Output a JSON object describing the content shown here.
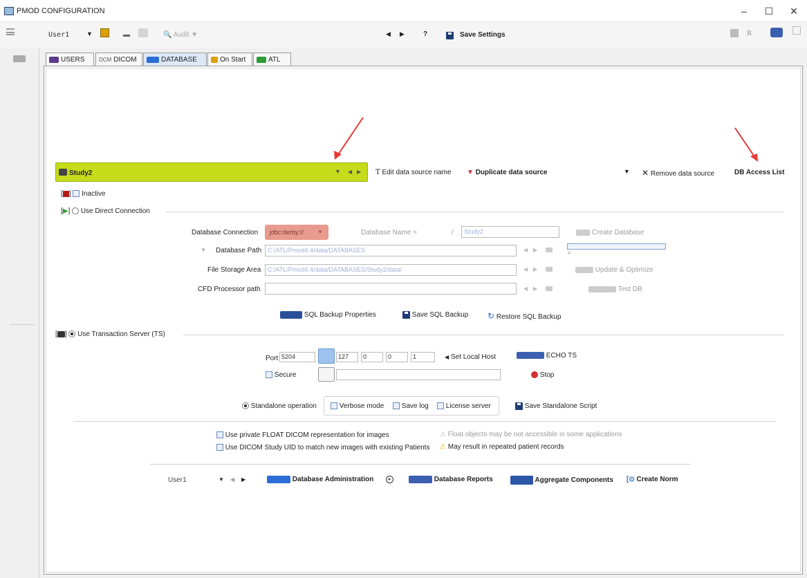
{
  "window": {
    "title": "PMOD CONFIGURATION",
    "minimize": "–",
    "maximize": "☐",
    "close": "✕"
  },
  "toolbar": {
    "user": "User1",
    "audit": "Audit",
    "help": "?",
    "save_settings": "Save Settings",
    "right_r": "R"
  },
  "tabs": [
    {
      "label": "USERS"
    },
    {
      "label": "DICOM",
      "prefix": "DCM"
    },
    {
      "label": "DATABASE"
    },
    {
      "label": "On Start"
    },
    {
      "label": "ATL"
    }
  ],
  "datasource": {
    "name": "Study2",
    "edit_name": "Edit data source name",
    "duplicate": "Duplicate data source",
    "remove": "Remove data source",
    "access_list": "DB Access List",
    "inactive": "Inactive",
    "use_direct": "Use Direct Connection"
  },
  "direct": {
    "db_connection_label": "Database Connection",
    "db_connection_value": "jdbc:derby://",
    "db_name_label": "Database Name >",
    "db_name_sep": "/",
    "db_name_value": "Study2",
    "create_db": "Create Database",
    "db_path_label": "Database Path",
    "db_path_value": "C:/ATL/Pmod4.4/data/DATABASES",
    "file_storage_label": "File Storage Area",
    "file_storage_value": "C:/ATL/Pmod4.4/data/DATABASES/Study2/data/",
    "cfd_label": "CFD Processor path",
    "cfd_value": "",
    "update_optimize": "Update & Optimize",
    "test_db": "Test DB",
    "sql_backup_props": "SQL Backup Properties",
    "save_sql_backup": "Save SQL Backup",
    "restore_sql_backup": "Restore SQL Backup"
  },
  "ts": {
    "use_ts": "Use Transaction Server (TS)",
    "port_label": "Port",
    "port_value": "5204",
    "ip1": "127",
    "ip2": "0",
    "ip3": "0",
    "ip4": "1",
    "set_local_host": "Set Local Host",
    "echo_ts": "ECHO TS",
    "secure": "Secure",
    "stop": "Stop",
    "standalone": "Standalone operation",
    "verbose": "Verbose mode",
    "save_log": "Save log",
    "license_server": "License server",
    "save_standalone": "Save Standalone Script"
  },
  "options": {
    "float_dicom": "Use private FLOAT DICOM representation for images",
    "float_warning": "Float objects may be not accessible in some applications",
    "study_uid": "Use DICOM Study UID to match new images with existing Patients",
    "uid_warning": "May result in repeated patient records"
  },
  "bottom": {
    "user": "User1",
    "db_admin": "Database Administration",
    "db_reports": "Database Reports",
    "aggregate": "Aggregate Components",
    "create_norm": "Create Norm"
  },
  "colors": {
    "datasource_bg": "#c5dc1a",
    "db_conn_bg": "#e89a8e",
    "accent_red": "#e53935"
  }
}
